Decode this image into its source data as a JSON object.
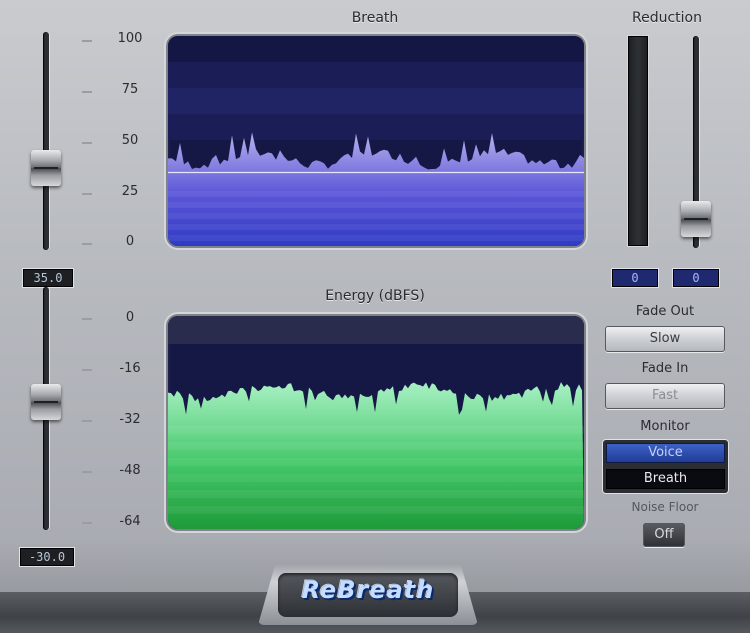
{
  "plugin": {
    "logo": "ReBreath"
  },
  "breath_display": {
    "title": "Breath",
    "scale": [
      "100",
      "75",
      "50",
      "25",
      "0"
    ],
    "threshold_percent": 35
  },
  "energy_display": {
    "title": "Energy (dBFS)",
    "scale": [
      "0",
      "-16",
      "-32",
      "-48",
      "-64"
    ]
  },
  "faders": {
    "breath_threshold": {
      "readout": "35.0",
      "level": 0.35
    },
    "energy_threshold": {
      "readout": "-30.0",
      "level": 0.53
    },
    "reduction": {
      "readout_left": "0",
      "readout_right": "0",
      "level": 0.06
    }
  },
  "reduction": {
    "title": "Reduction",
    "meter_level": 0.0
  },
  "fade_out": {
    "label": "Fade Out",
    "value": "Slow"
  },
  "fade_in": {
    "label": "Fade In",
    "value": "Fast"
  },
  "monitor": {
    "label": "Monitor",
    "options": [
      "Voice",
      "Breath"
    ],
    "selected": "Breath"
  },
  "noise_floor": {
    "label": "Noise Floor",
    "value": "Off"
  },
  "colors": {
    "breath_fill_top": "#b6b2ec",
    "breath_fill_bottom": "#2f3bc4",
    "energy_fill_top": "#a9f0c4",
    "energy_fill_bottom": "#1e9a3a",
    "screen_bg": "#151845"
  }
}
